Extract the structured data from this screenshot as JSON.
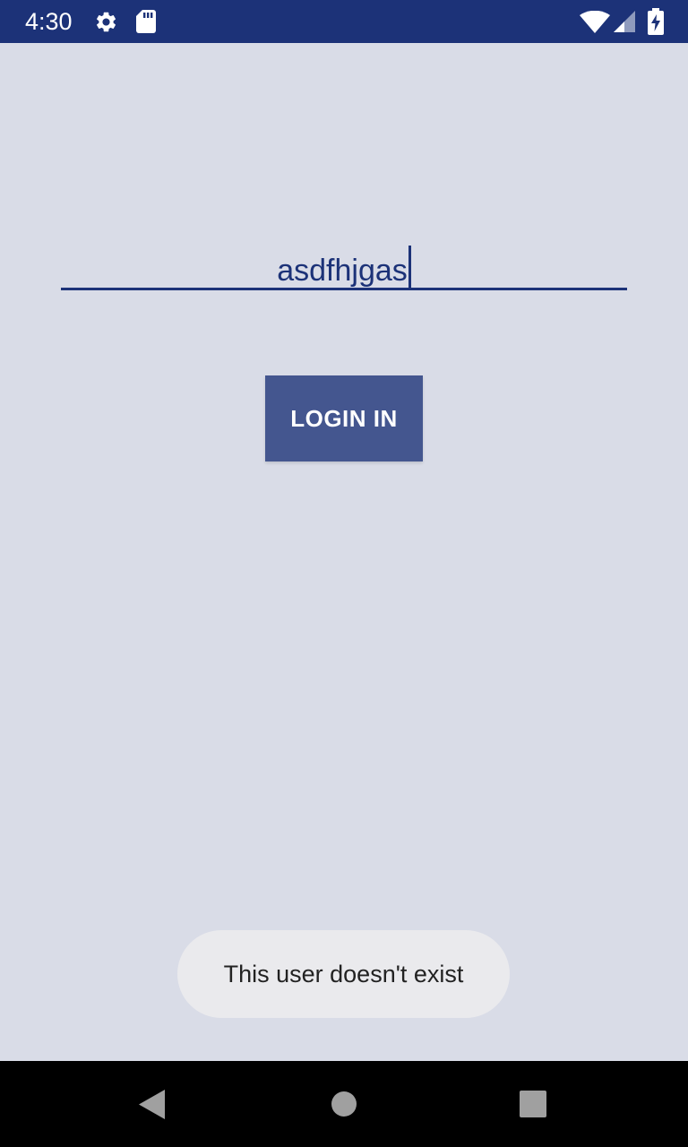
{
  "status_bar": {
    "time": "4:30",
    "icons": [
      "gear-icon",
      "sd-card-icon",
      "wifi-icon",
      "signal-icon",
      "battery-charging-icon"
    ],
    "background": "#1c3278"
  },
  "login": {
    "username_value": "asdfhjgas",
    "button_label": "LOGIN IN",
    "accent_color": "#1c3278",
    "button_color": "#44568f"
  },
  "toast": {
    "message": "This user doesn't exist"
  },
  "nav_bar": {
    "buttons": [
      "back-icon",
      "home-icon",
      "recents-icon"
    ]
  },
  "colors": {
    "background": "#d9dce7"
  }
}
